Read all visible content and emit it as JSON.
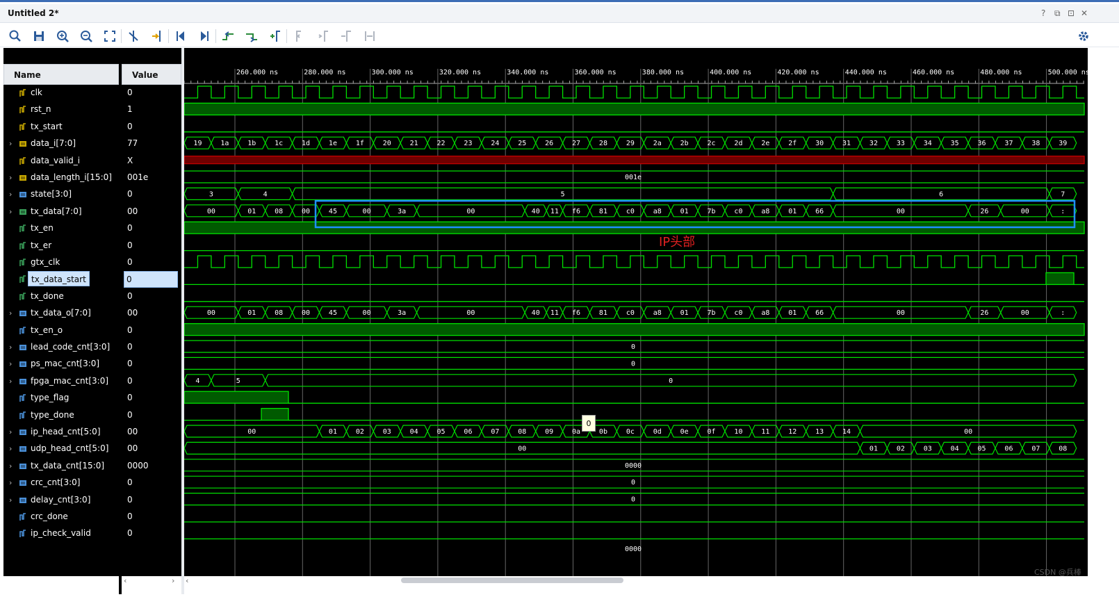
{
  "window": {
    "title": "Untitled 2*",
    "controls": [
      "?",
      "⧉",
      "⊡",
      "✕"
    ]
  },
  "toolbar": {
    "icons": [
      "search-icon",
      "save-icon",
      "zoom-in-icon",
      "zoom-out-icon",
      "zoom-fit-icon",
      "cursor-icon",
      "go-to-cursor-icon",
      "go-to-start-icon",
      "go-to-end-icon",
      "previous-transition-icon",
      "next-transition-icon",
      "add-marker-icon",
      "previous-marker-icon",
      "next-marker-icon",
      "swap-cursors-icon",
      "cursor-delta-icon"
    ],
    "settings_icon": "gear-icon"
  },
  "columns": {
    "name": "Name",
    "value": "Value"
  },
  "signals": [
    {
      "name": "clk",
      "value": "0",
      "bus": false,
      "icon": "signal-icon",
      "icon_color": "#c8a800"
    },
    {
      "name": "rst_n",
      "value": "1",
      "bus": false,
      "icon": "signal-icon",
      "icon_color": "#c8a800"
    },
    {
      "name": "tx_start",
      "value": "0",
      "bus": false,
      "icon": "signal-icon",
      "icon_color": "#c8a800"
    },
    {
      "name": "data_i[7:0]",
      "value": "77",
      "bus": true,
      "icon": "bus-icon",
      "icon_color": "#c8a800"
    },
    {
      "name": "data_valid_i",
      "value": "X",
      "bus": false,
      "icon": "signal-icon",
      "icon_color": "#c8a800"
    },
    {
      "name": "data_length_i[15:0]",
      "value": "001e",
      "bus": true,
      "icon": "bus-icon",
      "icon_color": "#c8a800"
    },
    {
      "name": "state[3:0]",
      "value": "0",
      "bus": true,
      "icon": "bus-icon",
      "icon_color": "#4a90d9"
    },
    {
      "name": "tx_data[7:0]",
      "value": "00",
      "bus": true,
      "icon": "bus-icon",
      "icon_color": "#3aa05a"
    },
    {
      "name": "tx_en",
      "value": "0",
      "bus": false,
      "icon": "signal-icon",
      "icon_color": "#3aa05a"
    },
    {
      "name": "tx_er",
      "value": "0",
      "bus": false,
      "icon": "signal-icon",
      "icon_color": "#3aa05a"
    },
    {
      "name": "gtx_clk",
      "value": "0",
      "bus": false,
      "icon": "signal-icon",
      "icon_color": "#3aa05a"
    },
    {
      "name": "tx_data_start",
      "value": "0",
      "bus": false,
      "icon": "signal-icon",
      "icon_color": "#3aa05a",
      "selected": true
    },
    {
      "name": "tx_done",
      "value": "0",
      "bus": false,
      "icon": "signal-icon",
      "icon_color": "#3aa05a"
    },
    {
      "name": "tx_data_o[7:0]",
      "value": "00",
      "bus": true,
      "icon": "bus-icon",
      "icon_color": "#4a90d9"
    },
    {
      "name": "tx_en_o",
      "value": "0",
      "bus": false,
      "icon": "signal-icon",
      "icon_color": "#4a90d9"
    },
    {
      "name": "lead_code_cnt[3:0]",
      "value": "0",
      "bus": true,
      "icon": "bus-icon",
      "icon_color": "#4a90d9"
    },
    {
      "name": "ps_mac_cnt[3:0]",
      "value": "0",
      "bus": true,
      "icon": "bus-icon",
      "icon_color": "#4a90d9"
    },
    {
      "name": "fpga_mac_cnt[3:0]",
      "value": "0",
      "bus": true,
      "icon": "bus-icon",
      "icon_color": "#4a90d9"
    },
    {
      "name": "type_flag",
      "value": "0",
      "bus": false,
      "icon": "signal-icon",
      "icon_color": "#4a90d9"
    },
    {
      "name": "type_done",
      "value": "0",
      "bus": false,
      "icon": "signal-icon",
      "icon_color": "#4a90d9"
    },
    {
      "name": "ip_head_cnt[5:0]",
      "value": "00",
      "bus": true,
      "icon": "bus-icon",
      "icon_color": "#4a90d9"
    },
    {
      "name": "udp_head_cnt[5:0]",
      "value": "00",
      "bus": true,
      "icon": "bus-icon",
      "icon_color": "#4a90d9"
    },
    {
      "name": "tx_data_cnt[15:0]",
      "value": "0000",
      "bus": true,
      "icon": "bus-icon",
      "icon_color": "#4a90d9"
    },
    {
      "name": "crc_cnt[3:0]",
      "value": "0",
      "bus": true,
      "icon": "bus-icon",
      "icon_color": "#4a90d9"
    },
    {
      "name": "delay_cnt[3:0]",
      "value": "0",
      "bus": true,
      "icon": "bus-icon",
      "icon_color": "#4a90d9"
    },
    {
      "name": "crc_done",
      "value": "0",
      "bus": false,
      "icon": "signal-icon",
      "icon_color": "#4a90d9"
    },
    {
      "name": "ip_check_valid",
      "value": "0",
      "bus": false,
      "icon": "signal-icon",
      "icon_color": "#4a90d9"
    }
  ],
  "timeline": {
    "labels": [
      "260.000 ns",
      "280.000 ns",
      "300.000 ns",
      "320.000 ns",
      "340.000 ns",
      "360.000 ns",
      "380.000 ns",
      "400.000 ns",
      "420.000 ns",
      "440.000 ns",
      "460.000 ns",
      "480.000 ns",
      "500.000 ns"
    ]
  },
  "waves": {
    "data_i_values": [
      "19",
      "1a",
      "1b",
      "1c",
      "1d",
      "1e",
      "1f",
      "20",
      "21",
      "22",
      "23",
      "24",
      "25",
      "26",
      "27",
      "28",
      "29",
      "2a",
      "2b",
      "2c",
      "2d",
      "2e",
      "2f",
      "30",
      "31",
      "32",
      "33",
      "34",
      "35",
      "36",
      "37",
      "38",
      "39"
    ],
    "data_length_value": "001e",
    "state_segments": [
      [
        "3",
        0,
        2
      ],
      [
        "4",
        2,
        4
      ],
      [
        "5",
        4,
        24
      ],
      [
        "6",
        24,
        32
      ],
      [
        "7",
        32,
        33
      ]
    ],
    "tx_data_segments": [
      [
        "00",
        0,
        2
      ],
      [
        "01",
        2,
        3
      ],
      [
        "08",
        3,
        4
      ],
      [
        "00",
        4,
        5
      ],
      [
        "45",
        5,
        6
      ],
      [
        "00",
        6,
        7.5
      ],
      [
        "3a",
        7.5,
        8.6
      ],
      [
        "00",
        8.6,
        12.6
      ],
      [
        "40",
        12.6,
        13.4
      ],
      [
        "11",
        13.4,
        14
      ],
      [
        "f6",
        14,
        15
      ],
      [
        "81",
        15,
        16
      ],
      [
        "c0",
        16,
        17
      ],
      [
        "a8",
        17,
        18
      ],
      [
        "01",
        18,
        19
      ],
      [
        "7b",
        19,
        20
      ],
      [
        "c0",
        20,
        21
      ],
      [
        "a8",
        21,
        22
      ],
      [
        "01",
        22,
        23
      ],
      [
        "66",
        23,
        24
      ],
      [
        "00",
        24,
        29
      ],
      [
        "26",
        29,
        30.2
      ],
      [
        "00",
        30.2,
        32
      ],
      [
        ":",
        32,
        33
      ]
    ],
    "lead_code_value": "0",
    "ps_mac_value": "0",
    "fpga_mac_segments": [
      [
        "4",
        0,
        1
      ],
      [
        "5",
        1,
        3
      ],
      [
        "0",
        3,
        33
      ]
    ],
    "ip_head_segments": [
      [
        "00",
        0,
        5
      ],
      [
        "01",
        5,
        6
      ],
      [
        "02",
        6,
        7
      ],
      [
        "03",
        7,
        8
      ],
      [
        "04",
        8,
        9
      ],
      [
        "05",
        9,
        10
      ],
      [
        "06",
        10,
        11
      ],
      [
        "07",
        11,
        12
      ],
      [
        "08",
        12,
        13
      ],
      [
        "09",
        13,
        14
      ],
      [
        "0a",
        14,
        15
      ],
      [
        "0b",
        15,
        16
      ],
      [
        "0c",
        16,
        17
      ],
      [
        "0d",
        17,
        18
      ],
      [
        "0e",
        18,
        19
      ],
      [
        "0f",
        19,
        20
      ],
      [
        "10",
        20,
        21
      ],
      [
        "11",
        21,
        22
      ],
      [
        "12",
        22,
        23
      ],
      [
        "13",
        23,
        24
      ],
      [
        "14",
        24,
        25
      ],
      [
        "00",
        25,
        33
      ]
    ],
    "udp_head_segments": [
      [
        "00",
        0,
        25
      ],
      [
        "01",
        25,
        26
      ],
      [
        "02",
        26,
        27
      ],
      [
        "03",
        27,
        28
      ],
      [
        "04",
        28,
        29
      ],
      [
        "05",
        29,
        30
      ],
      [
        "06",
        30,
        31
      ],
      [
        "07",
        31,
        32
      ],
      [
        "08",
        32,
        33
      ]
    ],
    "tx_data_cnt_value": "0000",
    "crc_cnt_value": "0",
    "delay_cnt_value": "0",
    "bottom_partial": "0000"
  },
  "annotation": {
    "text": "IP头部",
    "color": "#e02020",
    "box_color": "#1e90ff"
  },
  "tooltip": {
    "text": "0"
  },
  "watermark": "CSDN @兵棒",
  "colors": {
    "wave": "#00e000",
    "bus_fill": "#005a00",
    "x_value": "#c00000",
    "grid": "#666666"
  }
}
